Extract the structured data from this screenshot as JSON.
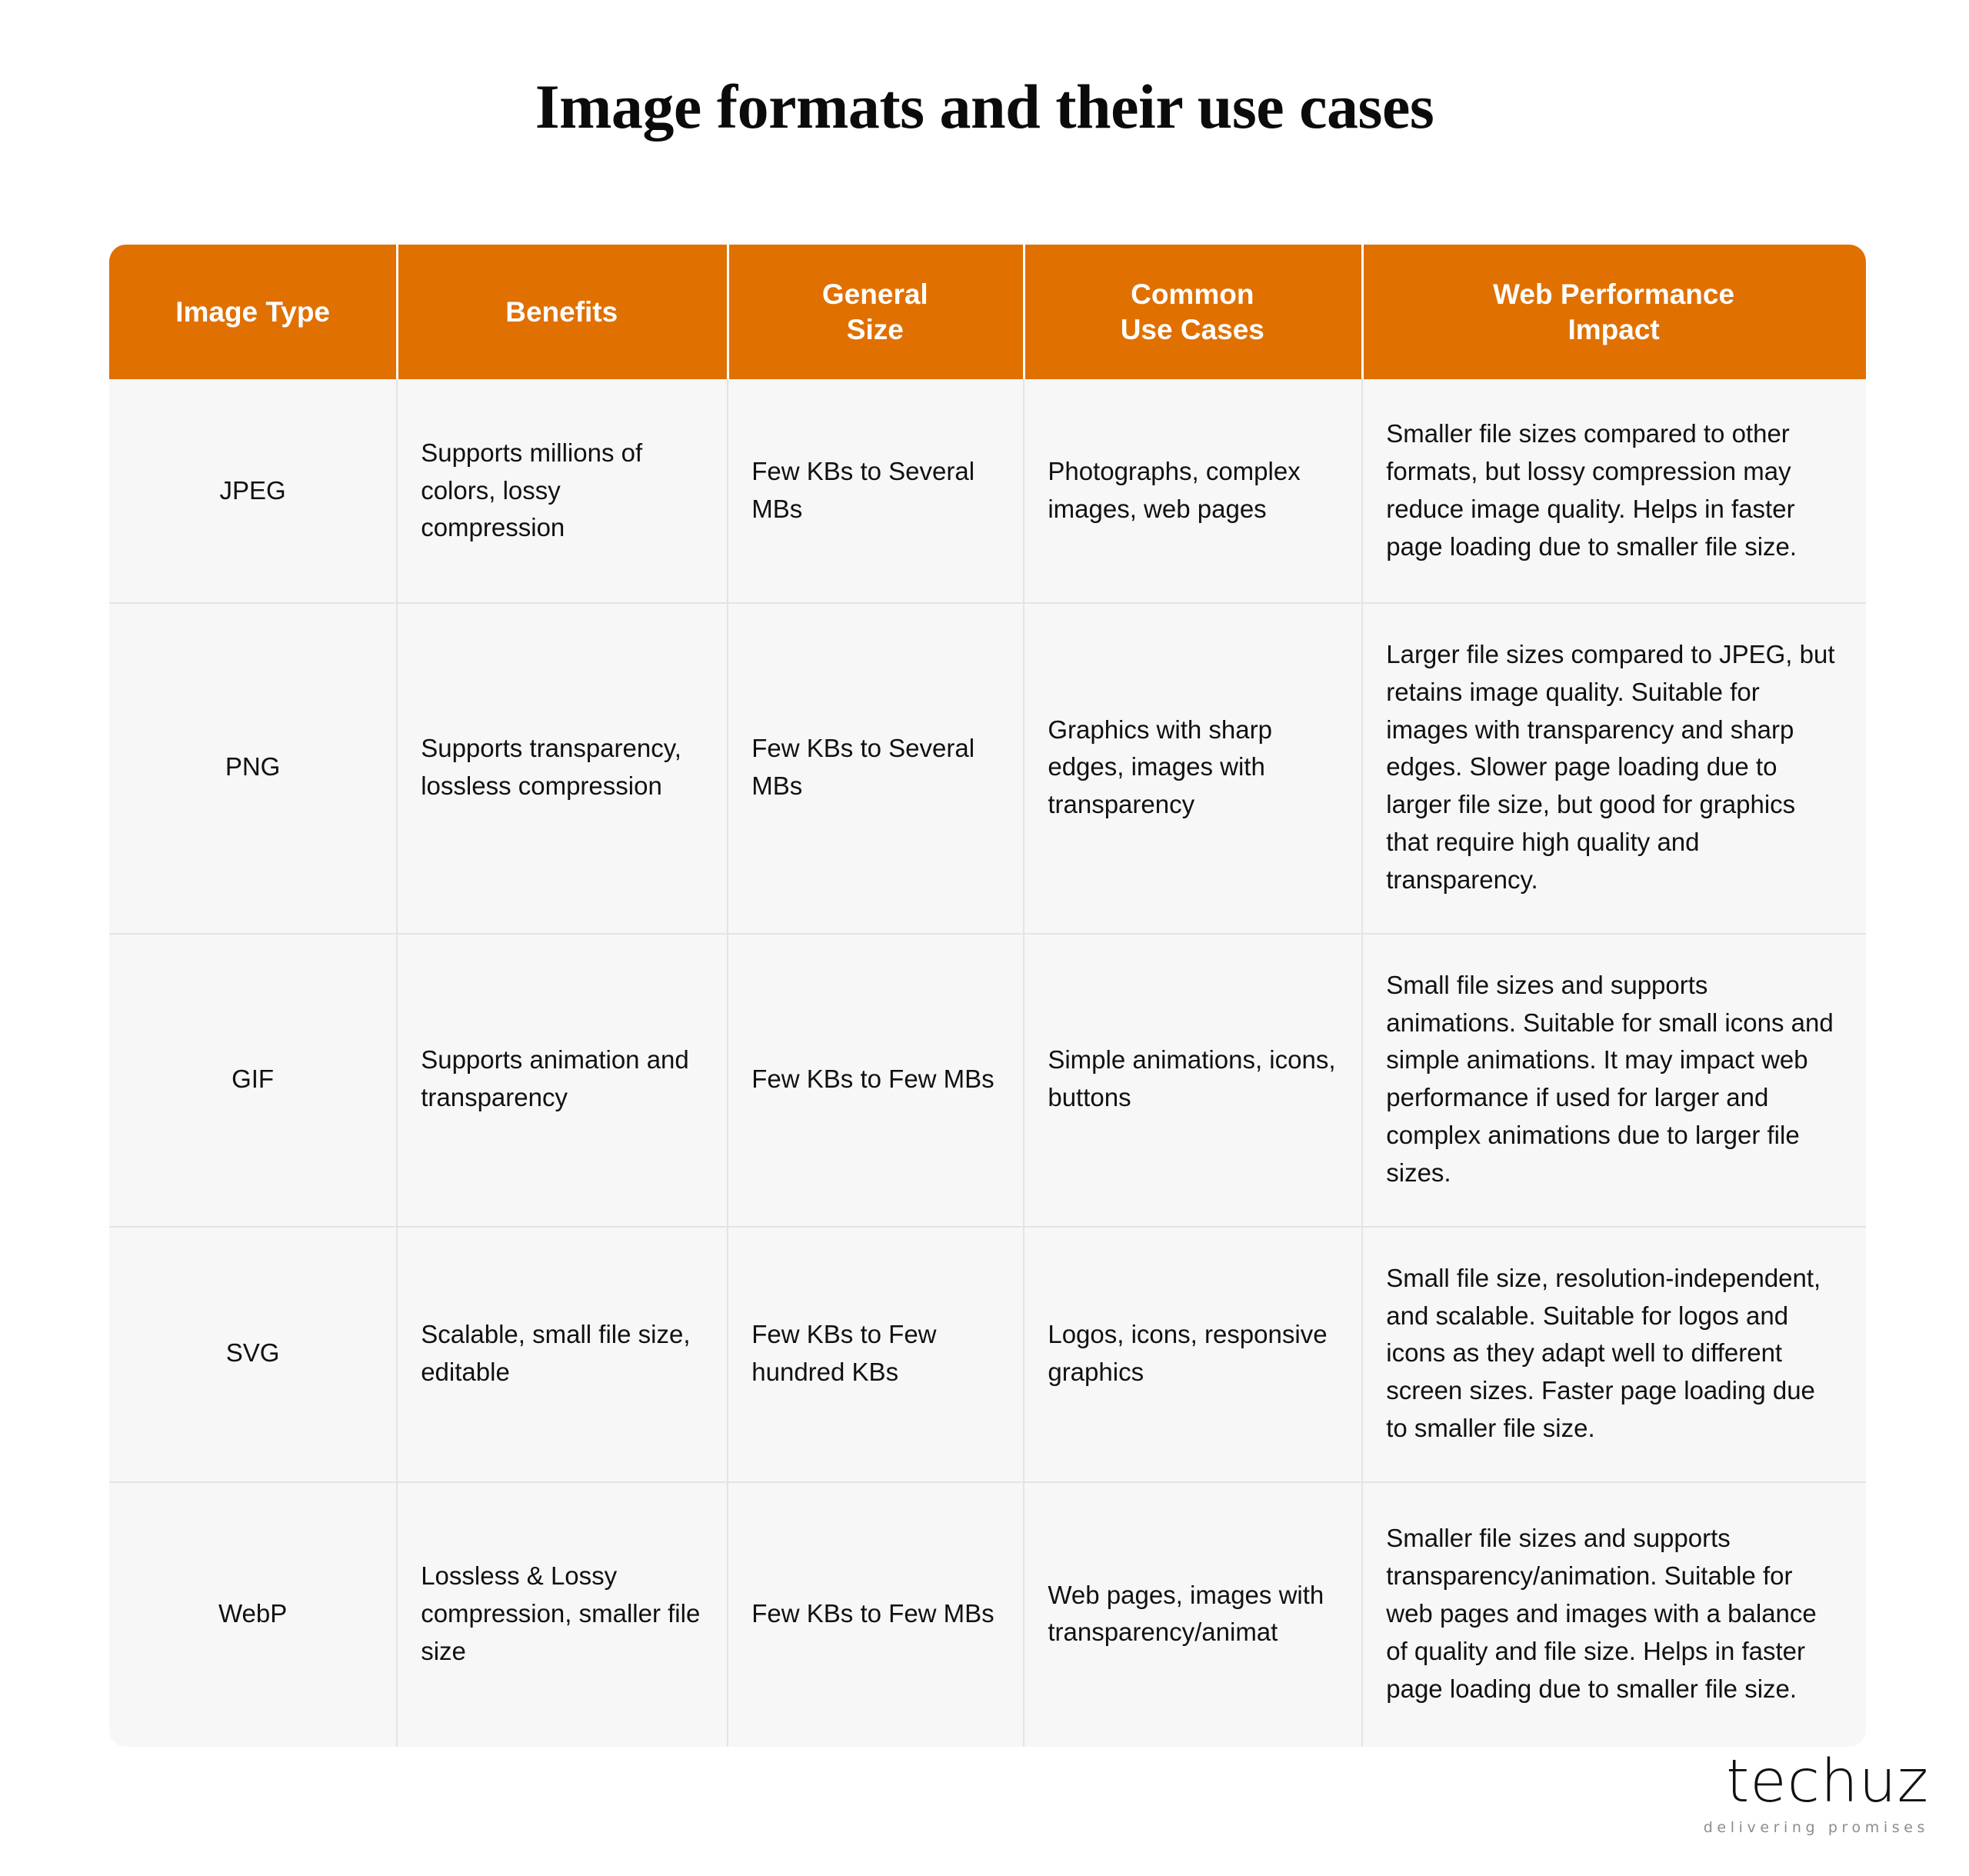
{
  "page": {
    "title": "Image formats and their use cases",
    "background_color": "#FFFFFF"
  },
  "theme": {
    "header_orange": "#E07000",
    "row_background": "#F7F7F7",
    "divider": "#E4E4E4",
    "header_text": "#FFFFFF",
    "body_text": "#111111"
  },
  "table": {
    "columns": [
      {
        "label": "Image Type"
      },
      {
        "label": "Benefits"
      },
      {
        "label": "General\nSize"
      },
      {
        "label": "Common\nUse Cases"
      },
      {
        "label": "Web Performance\nImpact"
      }
    ],
    "column_labels_line1": [
      "Image Type",
      "Benefits",
      "General",
      "Common",
      "Web Performance"
    ],
    "column_labels_line2": [
      "",
      "",
      "Size",
      "Use Cases",
      "Impact"
    ],
    "rows": [
      {
        "image_type": "JPEG",
        "benefits": "Supports millions of colors, lossy compression",
        "general_size": "Few KBs to Several MBs",
        "common_use_cases": "Photographs, complex images, web pages",
        "web_performance_impact": "Smaller file sizes compared to other formats, but lossy compression may reduce image quality. Helps in faster page loading due to smaller file size."
      },
      {
        "image_type": "PNG",
        "benefits": "Supports transparency, lossless compression",
        "general_size": "Few KBs to Several MBs",
        "common_use_cases": "Graphics with sharp edges, images with transparency",
        "web_performance_impact": "Larger file sizes compared to JPEG, but retains image quality. Suitable for images with transparency and sharp edges. Slower page loading due to larger file size, but good for graphics that require high quality and transparency."
      },
      {
        "image_type": "GIF",
        "benefits": "Supports animation and transparency",
        "general_size": "Few KBs to Few MBs",
        "common_use_cases": "Simple animations, icons, buttons",
        "web_performance_impact": "Small file sizes and supports animations. Suitable for small icons and simple animations. It may impact web performance if used for larger and complex animations due to larger file sizes."
      },
      {
        "image_type": "SVG",
        "benefits": "Scalable, small file size, editable",
        "general_size": "Few KBs to Few hundred KBs",
        "common_use_cases": "Logos, icons, responsive graphics",
        "web_performance_impact": "Small file size, resolution-independent, and scalable. Suitable for logos and icons as they adapt well to different screen sizes. Faster page loading due to smaller file size."
      },
      {
        "image_type": "WebP",
        "benefits": "Lossless & Lossy compression, smaller file size",
        "general_size": "Few KBs to Few MBs",
        "common_use_cases": "Web pages, images with transparency/animat",
        "web_performance_impact": "Smaller file sizes and supports transparency/animation. Suitable for web pages and images with a balance of quality and file size. Helps in faster page loading due to smaller file size."
      }
    ]
  },
  "logo": {
    "wordmark": "techuz",
    "tagline": "delivering promises"
  }
}
